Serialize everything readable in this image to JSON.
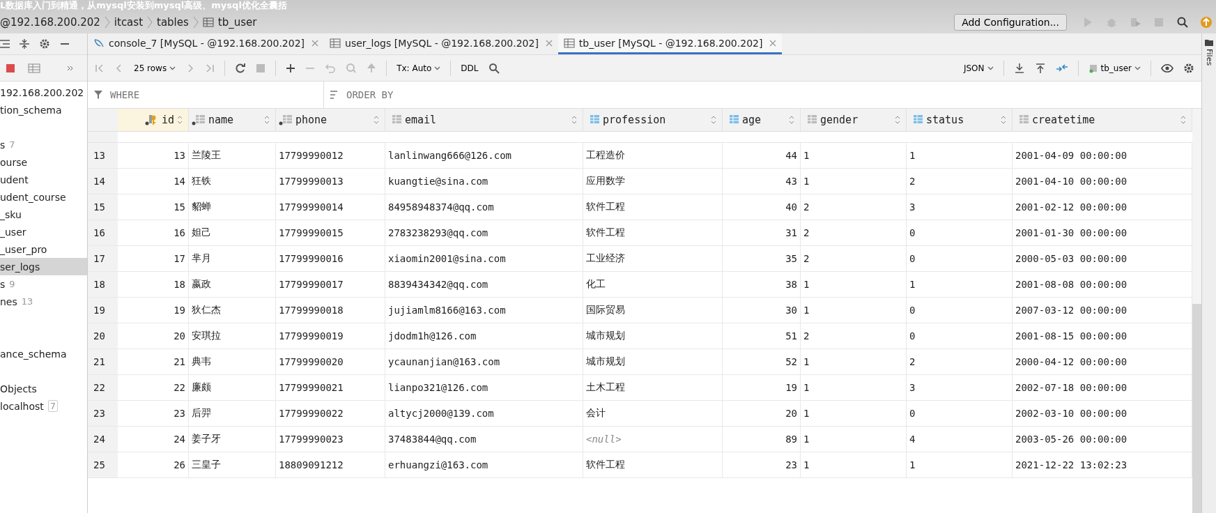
{
  "video_title": "L数据库入门到精通，从mysql安装到mysql高级、mysql优化全囊括",
  "breadcrumb": [
    "@192.168.200.202",
    "itcast",
    "tables",
    "tb_user"
  ],
  "run_config": "Add Configuration...",
  "tabs": [
    {
      "label": "console_7 [MySQL - @192.168.200.202]",
      "kind": "console",
      "selected": false
    },
    {
      "label": "user_logs [MySQL - @192.168.200.202]",
      "kind": "table",
      "selected": false
    },
    {
      "label": "tb_user [MySQL - @192.168.200.202]",
      "kind": "table",
      "selected": true
    }
  ],
  "toolbar": {
    "rows": "25 rows",
    "tx": "Tx: Auto",
    "ddl": "DDL",
    "format": "JSON",
    "target": "tb_user"
  },
  "filter": {
    "where": "WHERE",
    "order_by": "ORDER BY"
  },
  "tree": [
    {
      "label": "192.168.200.202",
      "selected": false
    },
    {
      "label": "tion_schema",
      "selected": false
    },
    {
      "kind": "blank"
    },
    {
      "label": "s",
      "count": "7",
      "selected": false
    },
    {
      "label": "ourse",
      "selected": false
    },
    {
      "label": "udent",
      "selected": false
    },
    {
      "label": "udent_course",
      "selected": false
    },
    {
      "label": "_sku",
      "selected": false
    },
    {
      "label": "_user",
      "selected": false
    },
    {
      "label": "_user_pro",
      "selected": false
    },
    {
      "label": "ser_logs",
      "selected": true
    },
    {
      "label": "s",
      "count": "9",
      "selected": false
    },
    {
      "label": "nes",
      "count": "13",
      "selected": false
    },
    {
      "kind": "blank"
    },
    {
      "kind": "blank"
    },
    {
      "label": "ance_schema",
      "selected": false
    },
    {
      "kind": "blank"
    },
    {
      "label": "Objects",
      "selected": false
    },
    {
      "label": "localhost",
      "count": "7",
      "boxed": true,
      "selected": false
    }
  ],
  "columns": [
    {
      "name": "id",
      "kind": "key",
      "not_null": true
    },
    {
      "name": "name",
      "kind": "plain",
      "not_null": true
    },
    {
      "name": "phone",
      "kind": "plain",
      "not_null": true
    },
    {
      "name": "email",
      "kind": "plain",
      "not_null": false
    },
    {
      "name": "profession",
      "kind": "indexed",
      "not_null": false
    },
    {
      "name": "age",
      "kind": "indexed",
      "not_null": false
    },
    {
      "name": "gender",
      "kind": "plain",
      "not_null": false
    },
    {
      "name": "status",
      "kind": "indexed",
      "not_null": false
    },
    {
      "name": "createtime",
      "kind": "plain",
      "not_null": false
    }
  ],
  "rows": [
    {
      "num": "13",
      "cells": [
        "13",
        "兰陵王",
        "17799990012",
        "lanlinwang666@126.com",
        "工程造价",
        "44",
        "1",
        "1",
        "2001-04-09 00:00:00"
      ],
      "profession_null": false
    },
    {
      "num": "14",
      "cells": [
        "14",
        "狂铁",
        "17799990013",
        "kuangtie@sina.com",
        "应用数学",
        "43",
        "1",
        "2",
        "2001-04-10 00:00:00"
      ],
      "profession_null": false
    },
    {
      "num": "15",
      "cells": [
        "15",
        "貂蝉",
        "17799990014",
        "84958948374@qq.com",
        "软件工程",
        "40",
        "2",
        "3",
        "2001-02-12 00:00:00"
      ],
      "profession_null": false
    },
    {
      "num": "16",
      "cells": [
        "16",
        "妲己",
        "17799990015",
        "2783238293@qq.com",
        "软件工程",
        "31",
        "2",
        "0",
        "2001-01-30 00:00:00"
      ],
      "profession_null": false
    },
    {
      "num": "17",
      "cells": [
        "17",
        "芈月",
        "17799990016",
        "xiaomin2001@sina.com",
        "工业经济",
        "35",
        "2",
        "0",
        "2000-05-03 00:00:00"
      ],
      "profession_null": false
    },
    {
      "num": "18",
      "cells": [
        "18",
        "嬴政",
        "17799990017",
        "8839434342@qq.com",
        "化工",
        "38",
        "1",
        "1",
        "2001-08-08 00:00:00"
      ],
      "profession_null": false
    },
    {
      "num": "19",
      "cells": [
        "19",
        "狄仁杰",
        "17799990018",
        "jujiamlm8166@163.com",
        "国际贸易",
        "30",
        "1",
        "0",
        "2007-03-12 00:00:00"
      ],
      "profession_null": false
    },
    {
      "num": "20",
      "cells": [
        "20",
        "安琪拉",
        "17799990019",
        "jdodm1h@126.com",
        "城市规划",
        "51",
        "2",
        "0",
        "2001-08-15 00:00:00"
      ],
      "profession_null": false
    },
    {
      "num": "21",
      "cells": [
        "21",
        "典韦",
        "17799990020",
        "ycaunanjian@163.com",
        "城市规划",
        "52",
        "1",
        "2",
        "2000-04-12 00:00:00"
      ],
      "profession_null": false
    },
    {
      "num": "22",
      "cells": [
        "22",
        "廉颇",
        "17799990021",
        "lianpo321@126.com",
        "土木工程",
        "19",
        "1",
        "3",
        "2002-07-18 00:00:00"
      ],
      "profession_null": false
    },
    {
      "num": "23",
      "cells": [
        "23",
        "后羿",
        "17799990022",
        "altycj2000@139.com",
        "会计",
        "20",
        "1",
        "0",
        "2002-03-10 00:00:00"
      ],
      "profession_null": false
    },
    {
      "num": "24",
      "cells": [
        "24",
        "姜子牙",
        "17799990023",
        "37483844@qq.com",
        "<null>",
        "89",
        "1",
        "4",
        "2003-05-26 00:00:00"
      ],
      "profession_null": true
    },
    {
      "num": "25",
      "cells": [
        "26",
        "三皇子",
        "18809091212",
        "erhuangzi@163.com",
        "软件工程",
        "23",
        "1",
        "1",
        "2021-12-22 13:02:23"
      ],
      "profession_null": false
    }
  ],
  "side_strip": "Files"
}
